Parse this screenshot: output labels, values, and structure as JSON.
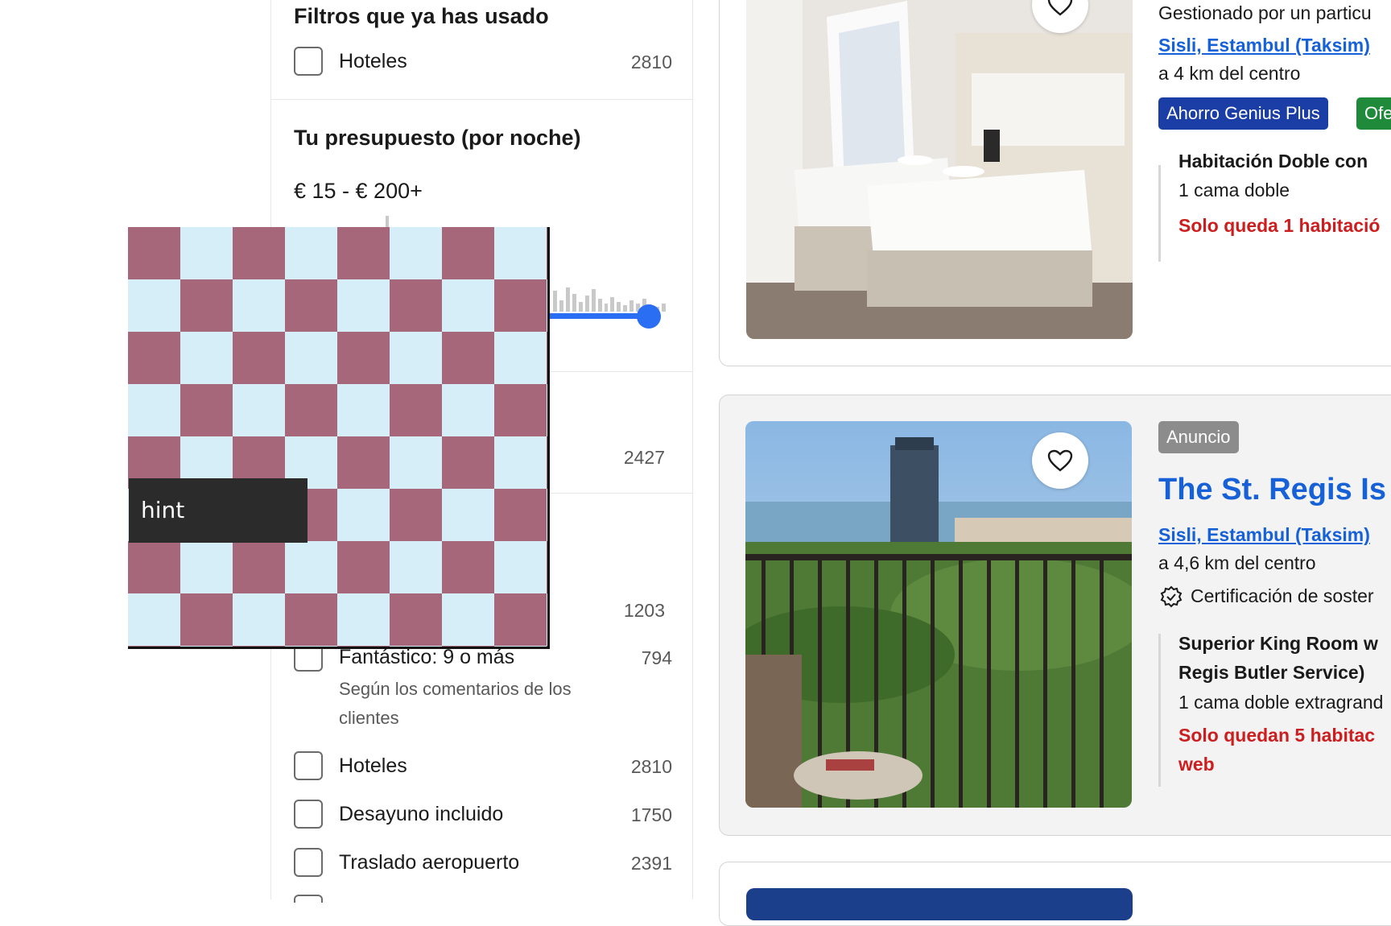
{
  "sidebar": {
    "used_filters_title": "Filtros que ya has usado",
    "used_filters": [
      {
        "label": "Hoteles",
        "count": "2810"
      }
    ],
    "budget_title": "Tu presupuesto (por noche)",
    "budget_range": "€ 15 - € 200+",
    "hidden_row_count": "2427",
    "row_1203": "1203",
    "popular_filters": [
      {
        "label": "Fantástico: 9 o más",
        "count": "794",
        "sub": "Según los comentarios de los clientes"
      },
      {
        "label": "Hoteles",
        "count": "2810"
      },
      {
        "label": "Desayuno incluido",
        "count": "1750"
      },
      {
        "label": "Traslado aeropuerto",
        "count": "2391"
      }
    ]
  },
  "cards": [
    {
      "managed": "Gestionado por un particu",
      "location": "Sisli, Estambul (Taksim)",
      "distance": "a 4 km del centro",
      "badges": [
        "Ahorro Genius Plus",
        "Ofe"
      ],
      "room_title": "Habitación Doble con",
      "room_bed": "1 cama doble",
      "availability": "Solo queda 1 habitació"
    },
    {
      "ad_badge": "Anuncio",
      "name": "The St. Regis Is",
      "location": "Sisli, Estambul (Taksim)",
      "distance": "a 4,6 km del centro",
      "certification": "Certificación de soster",
      "room_title_1": "Superior King Room w",
      "room_title_2": "Regis Butler Service)",
      "room_bed": "1 cama doble extragrand",
      "availability_1": "Solo quedan 5 habitac",
      "availability_2": "web"
    }
  ],
  "overlay": {
    "hint": "hint"
  },
  "colors": {
    "accent": "#1660d8",
    "genius": "#1b3ea6",
    "offer": "#1f8a3a",
    "alert": "#cc1e1e",
    "ad": "#8c8c8c"
  }
}
